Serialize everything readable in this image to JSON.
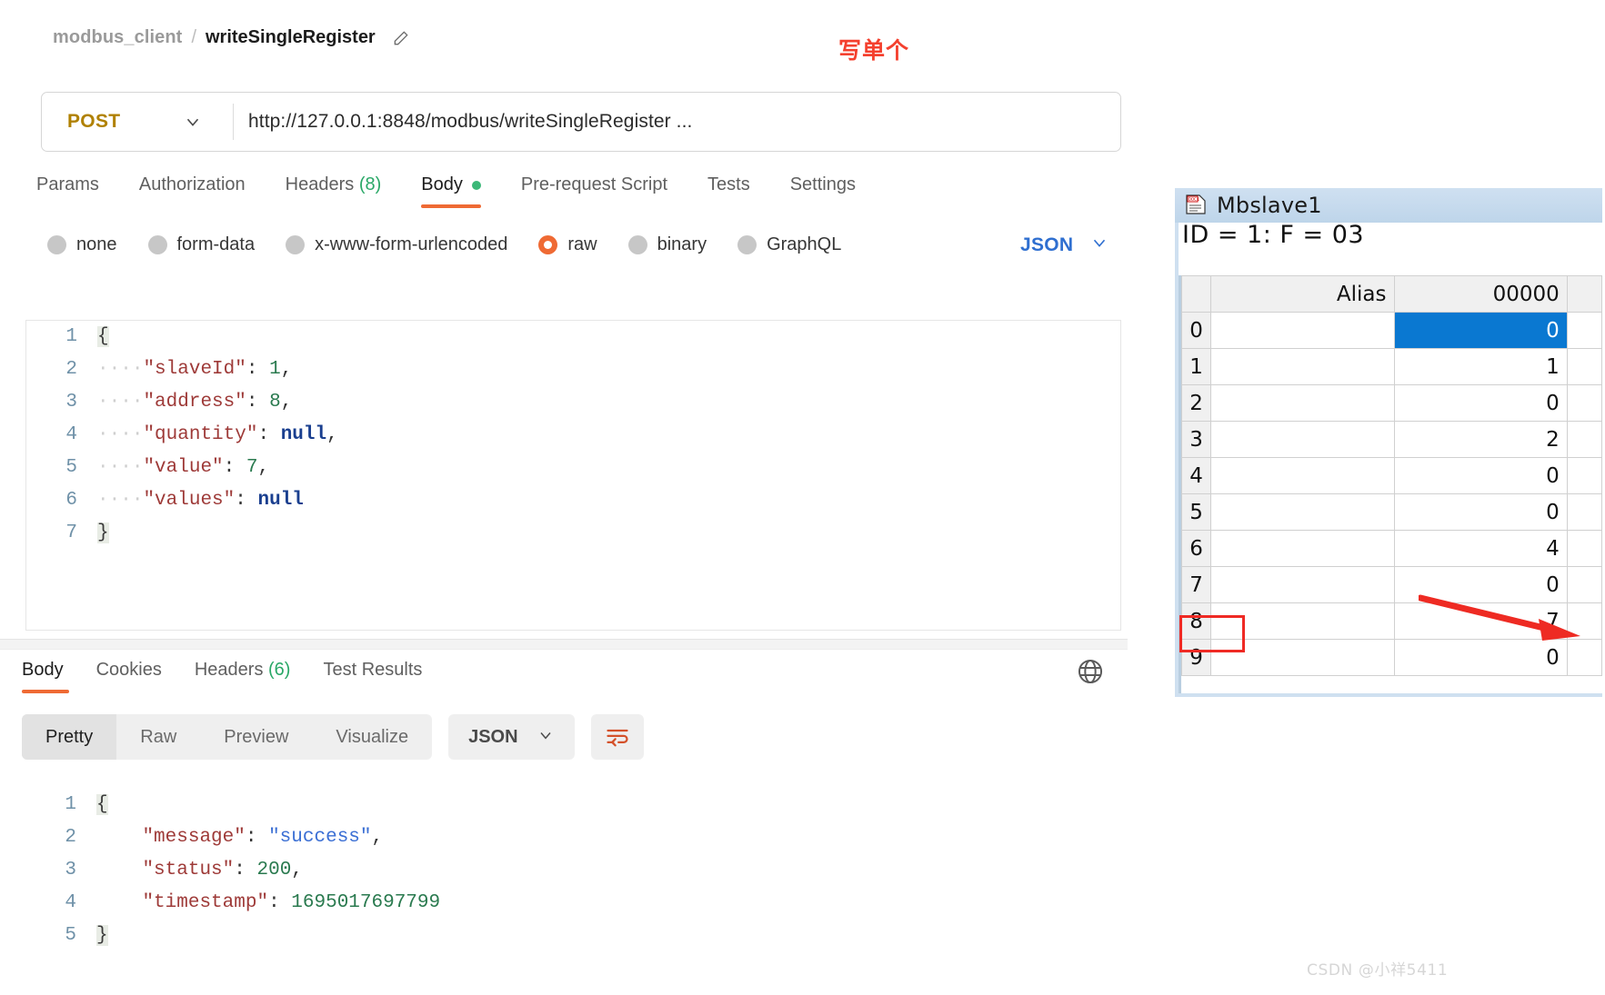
{
  "breadcrumb": {
    "collection": "modbus_client",
    "separator": "/",
    "request_name": "writeSingleRegister",
    "edit_icon": "pencil-icon"
  },
  "annotation": {
    "note_text": "写单个",
    "note_color": "#f4402e",
    "arrow_color": "#ef2a24",
    "highlight_box_color": "#ef2a24"
  },
  "url_bar": {
    "method": "POST",
    "method_caret": "chevron-down-icon",
    "url": "http://127.0.0.1:8848/modbus/writeSingleRegister ..."
  },
  "request_tabs": [
    {
      "label": "Params",
      "count": "",
      "active": false,
      "dot": false
    },
    {
      "label": "Authorization",
      "count": "",
      "active": false,
      "dot": false
    },
    {
      "label": "Headers",
      "count": "(8)",
      "active": false,
      "dot": false
    },
    {
      "label": "Body",
      "count": "",
      "active": true,
      "dot": true
    },
    {
      "label": "Pre-request Script",
      "count": "",
      "active": false,
      "dot": false
    },
    {
      "label": "Tests",
      "count": "",
      "active": false,
      "dot": false
    },
    {
      "label": "Settings",
      "count": "",
      "active": false,
      "dot": false
    }
  ],
  "body_types": [
    {
      "label": "none",
      "selected": false
    },
    {
      "label": "form-data",
      "selected": false
    },
    {
      "label": "x-www-form-urlencoded",
      "selected": false
    },
    {
      "label": "raw",
      "selected": true
    },
    {
      "label": "binary",
      "selected": false
    },
    {
      "label": "GraphQL",
      "selected": false
    }
  ],
  "body_format": {
    "label": "JSON",
    "caret": "chevron-down-icon",
    "color": "#2f6fd0"
  },
  "request_body": {
    "lines": [
      {
        "no": "1",
        "text": "{"
      },
      {
        "no": "2",
        "text": "····\"slaveId\": 1,"
      },
      {
        "no": "3",
        "text": "····\"address\": 8,"
      },
      {
        "no": "4",
        "text": "····\"quantity\": null,"
      },
      {
        "no": "5",
        "text": "····\"value\": 7,"
      },
      {
        "no": "6",
        "text": "····\"values\": null"
      },
      {
        "no": "7",
        "text": "}"
      }
    ],
    "json": {
      "slaveId": 1,
      "address": 8,
      "quantity": null,
      "value": 7,
      "values": null
    }
  },
  "response_tabs": [
    {
      "label": "Body",
      "count": "",
      "active": true
    },
    {
      "label": "Cookies",
      "count": "",
      "active": false
    },
    {
      "label": "Headers",
      "count": "(6)",
      "active": false
    },
    {
      "label": "Test Results",
      "count": "",
      "active": false
    }
  ],
  "response_globe_icon": "globe-icon",
  "response_toolbar": {
    "segments": [
      {
        "label": "Pretty",
        "active": true
      },
      {
        "label": "Raw",
        "active": false
      },
      {
        "label": "Preview",
        "active": false
      },
      {
        "label": "Visualize",
        "active": false
      }
    ],
    "format": {
      "label": "JSON",
      "caret": "chevron-down-icon"
    },
    "wrap_icon": "word-wrap-icon"
  },
  "response_body": {
    "lines": [
      {
        "no": "1",
        "text": "{"
      },
      {
        "no": "2",
        "text": "    \"message\": \"success\","
      },
      {
        "no": "3",
        "text": "    \"status\": 200,"
      },
      {
        "no": "4",
        "text": "    \"timestamp\": 1695017697799"
      },
      {
        "no": "5",
        "text": "}"
      }
    ],
    "json": {
      "message": "success",
      "status": 200,
      "timestamp": 1695017697799
    }
  },
  "mbslave": {
    "window_icon": "document-icon",
    "title": "Mbslave1",
    "status": "ID = 1: F = 03",
    "columns": [
      "",
      "Alias",
      "00000"
    ],
    "rows": [
      {
        "index": "0",
        "alias": "",
        "value": "0",
        "selected": true,
        "highlighted": false
      },
      {
        "index": "1",
        "alias": "",
        "value": "1",
        "selected": false,
        "highlighted": false
      },
      {
        "index": "2",
        "alias": "",
        "value": "0",
        "selected": false,
        "highlighted": false
      },
      {
        "index": "3",
        "alias": "",
        "value": "2",
        "selected": false,
        "highlighted": false
      },
      {
        "index": "4",
        "alias": "",
        "value": "0",
        "selected": false,
        "highlighted": false
      },
      {
        "index": "5",
        "alias": "",
        "value": "0",
        "selected": false,
        "highlighted": false
      },
      {
        "index": "6",
        "alias": "",
        "value": "4",
        "selected": false,
        "highlighted": false
      },
      {
        "index": "7",
        "alias": "",
        "value": "0",
        "selected": false,
        "highlighted": false
      },
      {
        "index": "8",
        "alias": "",
        "value": "7",
        "selected": false,
        "highlighted": true
      },
      {
        "index": "9",
        "alias": "",
        "value": "0",
        "selected": false,
        "highlighted": false
      }
    ],
    "selection_color": "#0a78d1"
  },
  "watermark": "CSDN @小祥5411"
}
